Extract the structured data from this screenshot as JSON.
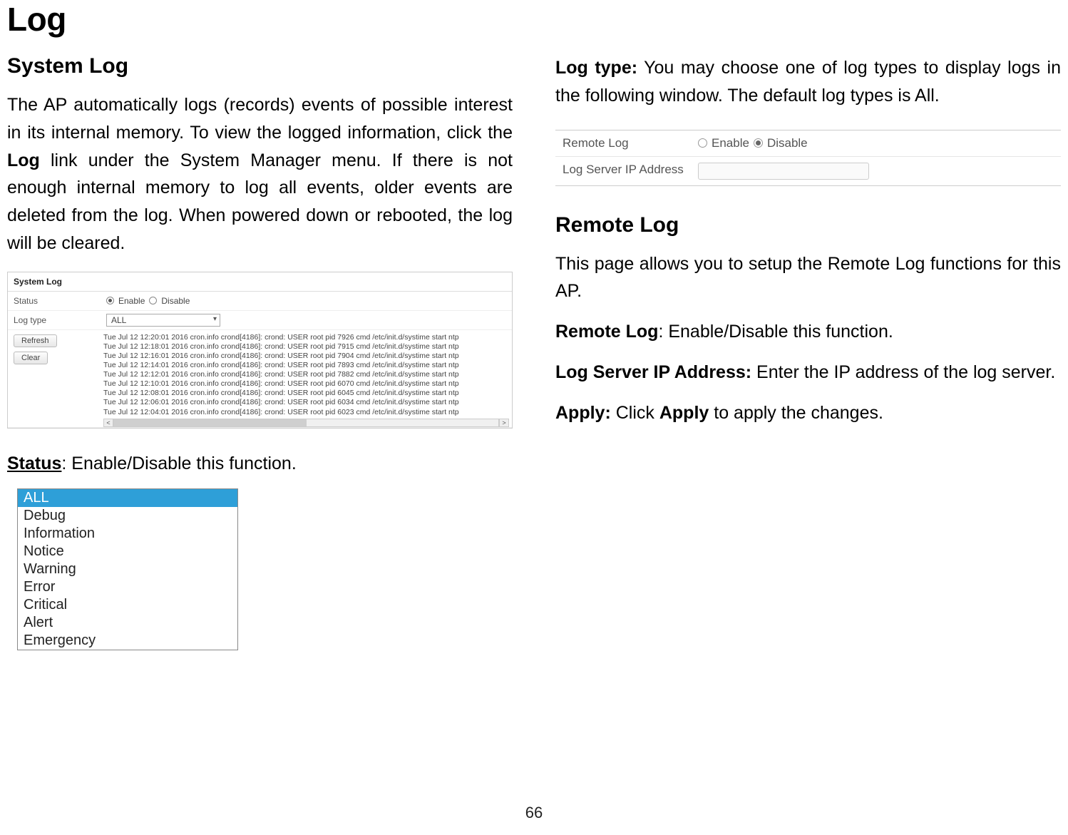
{
  "page": {
    "title": "Log",
    "footer_page_number": "66"
  },
  "left": {
    "heading": "System Log",
    "para_pre": "The AP automatically logs (records) events of possible interest in its internal memory. To view the logged information, click the ",
    "para_bold": "Log",
    "para_post": " link under the System Manager menu. If there is not enough internal memory to log all events, older events are deleted from the log. When powered down or rebooted, the log will be cleared.",
    "status_label": "Status",
    "status_desc": ": Enable/Disable this function."
  },
  "syslog": {
    "panel_title": "System Log",
    "status_label": "Status",
    "enable_label": "Enable",
    "disable_label": "Disable",
    "logtype_label": "Log type",
    "logtype_value": "ALL",
    "refresh": "Refresh",
    "clear": "Clear",
    "lines": [
      "Tue Jul 12 12:20:01 2016 cron.info crond[4186]: crond: USER root pid 7926 cmd /etc/init.d/systime start ntp",
      "Tue Jul 12 12:18:01 2016 cron.info crond[4186]: crond: USER root pid 7915 cmd /etc/init.d/systime start ntp",
      "Tue Jul 12 12:16:01 2016 cron.info crond[4186]: crond: USER root pid 7904 cmd /etc/init.d/systime start ntp",
      "Tue Jul 12 12:14:01 2016 cron.info crond[4186]: crond: USER root pid 7893 cmd /etc/init.d/systime start ntp",
      "Tue Jul 12 12:12:01 2016 cron.info crond[4186]: crond: USER root pid 7882 cmd /etc/init.d/systime start ntp",
      "Tue Jul 12 12:10:01 2016 cron.info crond[4186]: crond: USER root pid 6070 cmd /etc/init.d/systime start ntp",
      "Tue Jul 12 12:08:01 2016 cron.info crond[4186]: crond: USER root pid 6045 cmd /etc/init.d/systime start ntp",
      "Tue Jul 12 12:06:01 2016 cron.info crond[4186]: crond: USER root pid 6034 cmd /etc/init.d/systime start ntp",
      "Tue Jul 12 12:04:01 2016 cron.info crond[4186]: crond: USER root pid 6023 cmd /etc/init.d/systime start ntp"
    ]
  },
  "logtype_list": [
    "ALL",
    "Debug",
    "Information",
    "Notice",
    "Warning",
    "Error",
    "Critical",
    "Alert",
    "Emergency"
  ],
  "right": {
    "logtype_label": "Log type:",
    "logtype_desc": " You may choose one of log types to display logs in the following window. The default log types is All.",
    "remote_heading": "Remote Log",
    "remote_desc": "This page allows you to setup the Remote Log functions for this AP.",
    "remotelog_label": "Remote Log",
    "remotelog_desc": ": Enable/Disable this function.",
    "logserver_label": "Log Server IP Address:",
    "logserver_desc": " Enter the IP address of the log server.",
    "apply_label": "Apply:",
    "apply_mid": " Click ",
    "apply_bold": "Apply",
    "apply_post": " to apply the changes."
  },
  "remote_panel": {
    "remote_log_label": "Remote Log",
    "enable": "Enable",
    "disable": "Disable",
    "ip_label": "Log Server IP Address"
  }
}
